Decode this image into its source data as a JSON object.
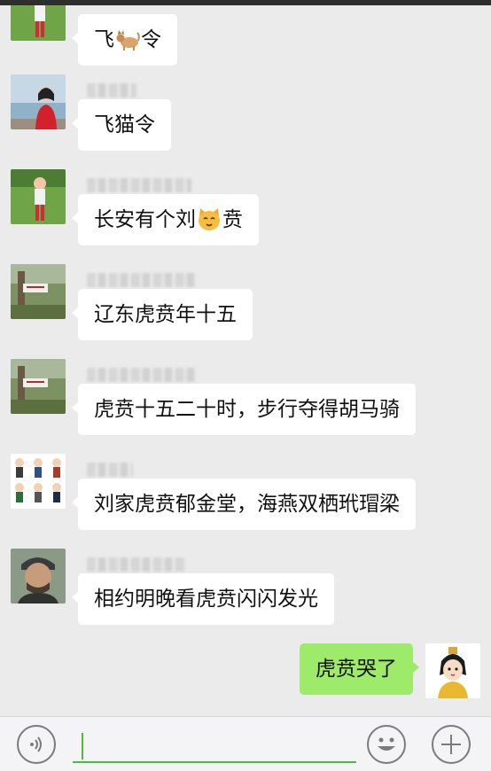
{
  "messages": [
    {
      "side": "left",
      "sender": "",
      "avatar": "girl-on-grass-avatar",
      "text": [
        "飞",
        "令"
      ],
      "emoji": "cat-photo-emoji"
    },
    {
      "side": "left",
      "sender": "",
      "avatar": "woman-by-lake-avatar",
      "text": [
        "飞猫令"
      ]
    },
    {
      "side": "left",
      "sender": "",
      "avatar": "girl-on-grass-avatar",
      "text": [
        "长安有个刘",
        "贲"
      ],
      "emoji": "cat-face-emoji"
    },
    {
      "side": "left",
      "sender": "",
      "avatar": "tree-with-sign-avatar",
      "text": [
        "辽东虎贲年十五"
      ]
    },
    {
      "side": "left",
      "sender": "",
      "avatar": "tree-with-sign-avatar",
      "text": [
        "虎贲十五二十时，步行夺得胡马骑"
      ]
    },
    {
      "side": "left",
      "sender": "",
      "avatar": "cartoon-group-avatar",
      "text": [
        "刘家虎贲郁金堂，海燕双栖玳瑁梁"
      ]
    },
    {
      "side": "left",
      "sender": "",
      "avatar": "man-portrait-avatar",
      "text": [
        "相约明晚看虎贲闪闪发光"
      ]
    },
    {
      "side": "right",
      "sender": "",
      "avatar": "cartoon-lady-avatar",
      "text": [
        "虎贲哭了"
      ]
    }
  ],
  "input": {
    "value": "",
    "placeholder": ""
  },
  "icons": {
    "voice": "voice-icon",
    "emoji": "emoji-icon",
    "more": "plus-icon"
  },
  "colors": {
    "background": "#ebebeb",
    "bubble_in": "#ffffff",
    "bubble_out": "#9eea6a",
    "accent": "#4bbd36"
  }
}
